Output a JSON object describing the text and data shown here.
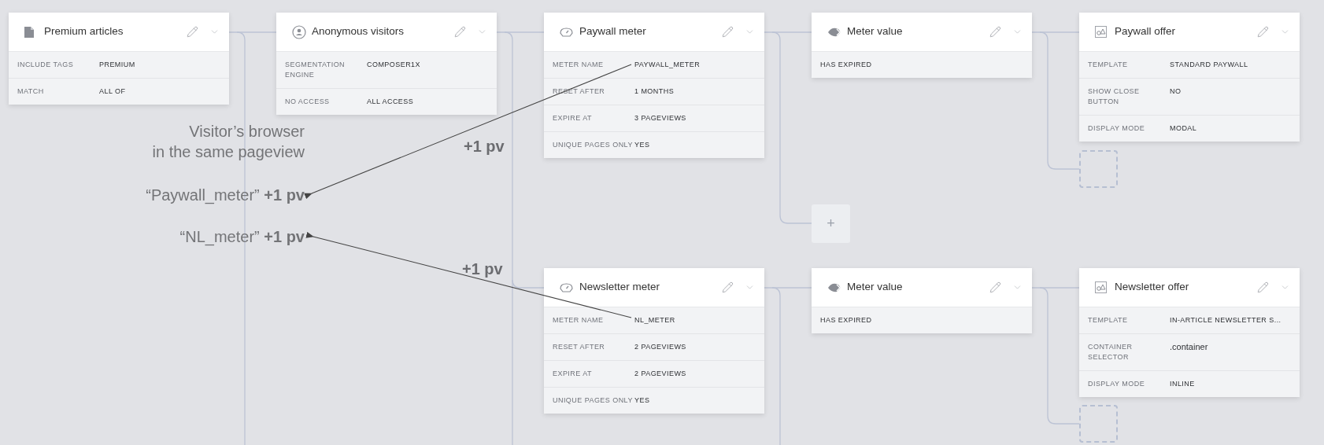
{
  "nodes": [
    {
      "kind": "document",
      "title": "Premium articles",
      "fields": [
        {
          "label": "INCLUDE TAGS",
          "value": "PREMIUM"
        },
        {
          "label": "MATCH",
          "value": "ALL OF"
        }
      ]
    },
    {
      "kind": "person",
      "title": "Anonymous visitors",
      "fields": [
        {
          "label": "SEGMENTATION ENGINE",
          "value": "COMPOSER1X"
        },
        {
          "label": "NO ACCESS",
          "value": "ALL ACCESS"
        }
      ]
    },
    {
      "kind": "gauge",
      "title": "Paywall meter",
      "fields": [
        {
          "label": "METER NAME",
          "value": "PAYWALL_METER"
        },
        {
          "label": "RESET AFTER",
          "value": "1 MONTHS"
        },
        {
          "label": "EXPIRE AT",
          "value": "3 PAGEVIEWS"
        },
        {
          "label": "UNIQUE PAGES ONLY",
          "value": "YES"
        }
      ]
    },
    {
      "kind": "eye",
      "title": "Meter value",
      "fields": [
        {
          "value": "HAS EXPIRED"
        }
      ]
    },
    {
      "kind": "image",
      "title": "Paywall offer",
      "fields": [
        {
          "label": "TEMPLATE",
          "value": "STANDARD PAYWALL"
        },
        {
          "label": "SHOW CLOSE BUTTON",
          "value": "NO"
        },
        {
          "label": "DISPLAY MODE",
          "value": "MODAL"
        }
      ]
    },
    {
      "kind": "gauge",
      "title": "Newsletter meter",
      "fields": [
        {
          "label": "METER NAME",
          "value": "NL_METER"
        },
        {
          "label": "RESET AFTER",
          "value": "2 PAGEVIEWS"
        },
        {
          "label": "EXPIRE AT",
          "value": "2 PAGEVIEWS"
        },
        {
          "label": "UNIQUE PAGES ONLY",
          "value": "YES"
        }
      ]
    },
    {
      "kind": "eye",
      "title": "Meter value",
      "fields": [
        {
          "value": "HAS EXPIRED"
        }
      ]
    },
    {
      "kind": "image",
      "title": "Newsletter offer",
      "fields": [
        {
          "label": "TEMPLATE",
          "value": "IN-ARTICLE NEWSLETTER S..."
        },
        {
          "label": "CONTAINER SELECTOR",
          "value": ".container",
          "plain": true
        },
        {
          "label": "DISPLAY MODE",
          "value": "INLINE"
        }
      ]
    }
  ],
  "add_button": {
    "label": "+"
  },
  "annotations": {
    "browser_note": "Visitor’s browser\nin the same pageview",
    "paywall_note": "“Paywall_meter” **+1 pv**",
    "nl_note": "“NL_meter” **+1 pv**",
    "pv_labels": [
      "+1 pv",
      "+1 pv"
    ]
  }
}
